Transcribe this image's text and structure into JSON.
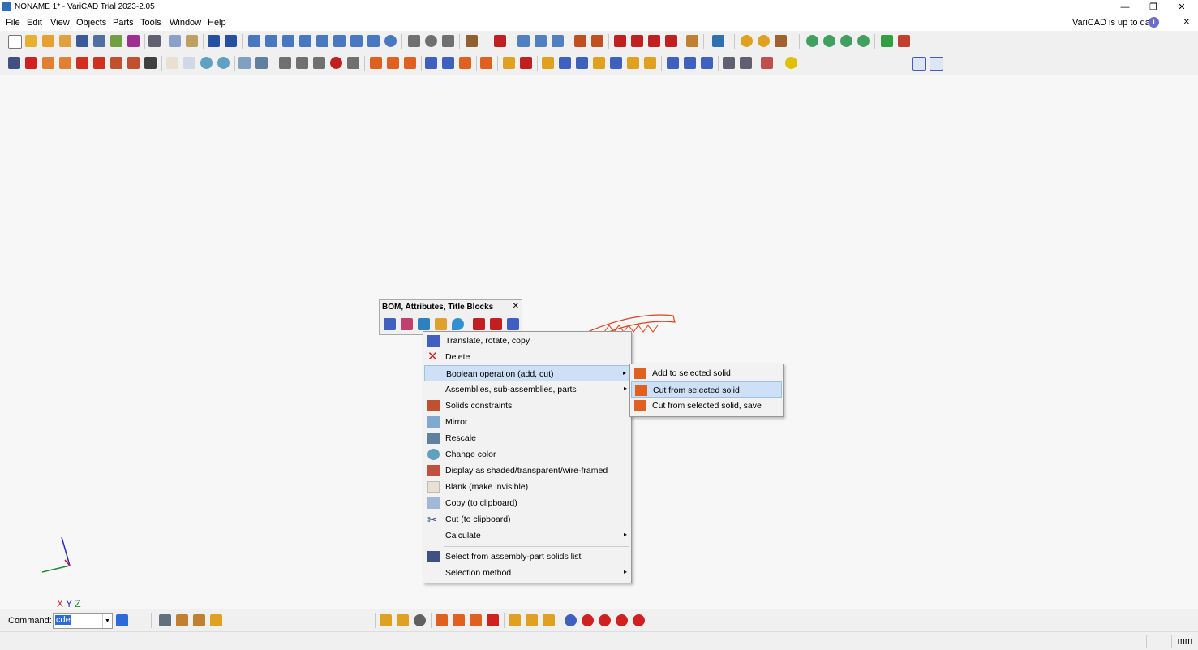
{
  "window": {
    "title": "NONAME 1* - VariCAD Trial 2023-2.05",
    "minimize": "—",
    "restore": "❐",
    "close": "✕"
  },
  "menubar": {
    "items": [
      "File",
      "Edit",
      "View",
      "Objects",
      "Parts",
      "Tools",
      "Window",
      "Help"
    ],
    "update_status": "VariCAD is up to date",
    "info_icon": "i",
    "dismiss": "✕"
  },
  "colors": {
    "accent": "#2b6cd9",
    "highlight": "#cde0f5",
    "axis_x": "#d02020",
    "axis_y": "#1f8a3a",
    "axis_z": "#2a2ad0",
    "model": "#e04020"
  },
  "bom_panel": {
    "title": "BOM, Attributes, Title Blocks",
    "close": "✕"
  },
  "context_menu": {
    "items": [
      {
        "label": "Translate, rotate, copy",
        "icon": "translate-icon"
      },
      {
        "label": "Delete",
        "icon": "delete-icon"
      },
      {
        "label": "Boolean operation (add, cut)",
        "icon": "",
        "submenu": true,
        "highlighted": true
      },
      {
        "label": "Assemblies, sub-assemblies, parts",
        "icon": "",
        "submenu": true
      },
      {
        "label": "Solids constraints",
        "icon": "constraints-icon"
      },
      {
        "label": "Mirror",
        "icon": "mirror-icon"
      },
      {
        "label": "Rescale",
        "icon": "rescale-icon"
      },
      {
        "label": "Change color",
        "icon": "color-icon"
      },
      {
        "label": "Display as shaded/transparent/wire-framed",
        "icon": "display-mode-icon"
      },
      {
        "label": "Blank (make invisible)",
        "icon": "blank-icon"
      },
      {
        "label": "Copy (to clipboard)",
        "icon": "copy-icon"
      },
      {
        "label": "Cut (to clipboard)",
        "icon": "scissors-icon"
      },
      {
        "label": "Calculate",
        "icon": "",
        "submenu": true
      },
      {
        "label": "Select from assembly-part solids list",
        "icon": "select-list-icon"
      },
      {
        "label": "Selection method",
        "icon": "",
        "submenu": true
      }
    ],
    "arrow": "▸"
  },
  "submenu": {
    "items": [
      {
        "label": "Add to selected solid",
        "icon": "boolean-add-icon"
      },
      {
        "label": "Cut from selected solid",
        "icon": "boolean-cut-icon",
        "highlighted": true
      },
      {
        "label": "Cut from selected solid, save",
        "icon": "boolean-cut-save-icon"
      }
    ]
  },
  "command": {
    "label": "Command:",
    "value": "cde",
    "dropdown": "▼"
  },
  "axes": {
    "x": "X",
    "y": "Y",
    "z": "Z"
  },
  "status": {
    "units": "mm"
  }
}
